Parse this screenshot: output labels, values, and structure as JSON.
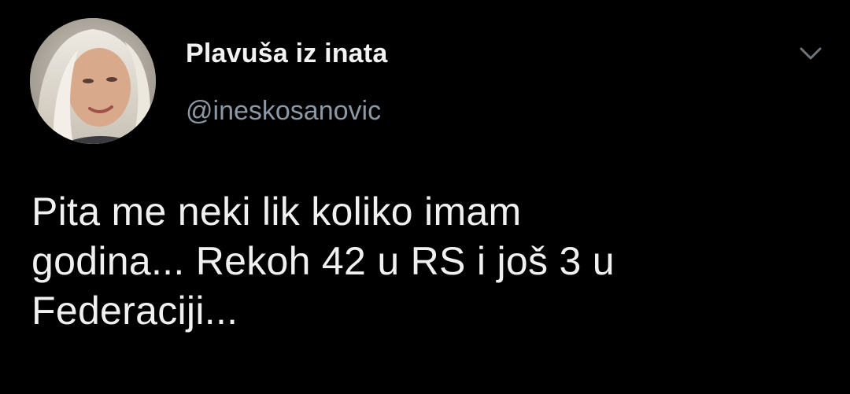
{
  "tweet": {
    "author": {
      "display_name": "Plavuša iz inata",
      "handle": "@ineskosanovic",
      "avatar_icon": "profile-photo-avatar"
    },
    "menu_icon": "chevron-down-icon",
    "text_lines": [
      "Pita me neki lik koliko imam",
      "godina... Rekoh 42 u RS i još 3 u",
      "Federaciji..."
    ]
  },
  "colors": {
    "background": "#000000",
    "primary_text": "#f0f0f0",
    "secondary_text": "#8b98a5",
    "icon": "#6e767d"
  }
}
